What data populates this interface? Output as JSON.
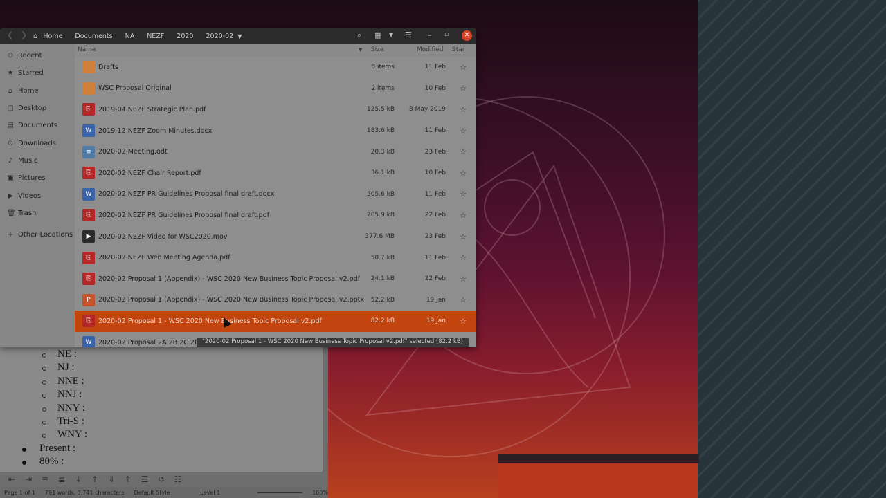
{
  "breadcrumb": {
    "items": [
      "Home",
      "Documents",
      "NA",
      "NEZF",
      "2020",
      "2020-02"
    ]
  },
  "icons": {
    "back": "chevron-left-icon",
    "forward": "chevron-right-icon",
    "home": "home-icon",
    "search": "search-icon",
    "view": "grid-view-icon",
    "menu": "hamburger-icon",
    "minimize": "minimize-icon",
    "maximize": "maximize-icon",
    "close": "close-icon"
  },
  "sidebar": {
    "items": [
      {
        "label": "Recent",
        "icon": "⏲"
      },
      {
        "label": "Starred",
        "icon": "★"
      },
      {
        "label": "Home",
        "icon": "⌂"
      },
      {
        "label": "Desktop",
        "icon": "▢"
      },
      {
        "label": "Documents",
        "icon": "▤"
      },
      {
        "label": "Downloads",
        "icon": "⊙"
      },
      {
        "label": "Music",
        "icon": "♪"
      },
      {
        "label": "Pictures",
        "icon": "▣"
      },
      {
        "label": "Videos",
        "icon": "▶"
      },
      {
        "label": "Trash",
        "icon": "🗑"
      },
      {
        "label": "Other Locations",
        "icon": "+"
      }
    ]
  },
  "columns": {
    "name": "Name",
    "size": "Size",
    "modified": "Modified",
    "star": "Star"
  },
  "files": [
    {
      "name": "Drafts",
      "size": "8 items",
      "modified": "11 Feb",
      "type": "folder"
    },
    {
      "name": "WSC Proposal Original",
      "size": "2 items",
      "modified": "10 Feb",
      "type": "folder"
    },
    {
      "name": "2019-04 NEZF Strategic Plan.pdf",
      "size": "125.5 kB",
      "modified": "8 May 2019",
      "type": "pdf"
    },
    {
      "name": "2019-12 NEZF Zoom Minutes.docx",
      "size": "183.6 kB",
      "modified": "11 Feb",
      "type": "doc"
    },
    {
      "name": "2020-02 Meeting.odt",
      "size": "20.3 kB",
      "modified": "23 Feb",
      "type": "odt"
    },
    {
      "name": "2020-02 NEZF Chair Report.pdf",
      "size": "36.1 kB",
      "modified": "10 Feb",
      "type": "pdf"
    },
    {
      "name": "2020-02 NEZF PR Guidelines Proposal final draft.docx",
      "size": "505.6 kB",
      "modified": "11 Feb",
      "type": "doc"
    },
    {
      "name": "2020-02 NEZF PR Guidelines Proposal final draft.pdf",
      "size": "205.9 kB",
      "modified": "22 Feb",
      "type": "pdf"
    },
    {
      "name": "2020-02 NEZF Video for WSC2020.mov",
      "size": "377.6 MB",
      "modified": "23 Feb",
      "type": "mov"
    },
    {
      "name": "2020-02 NEZF Web Meeting Agenda.pdf",
      "size": "50.7 kB",
      "modified": "11 Feb",
      "type": "pdf"
    },
    {
      "name": "2020-02 Proposal 1 (Appendix) - WSC 2020 New Business Topic Proposal v2.pdf",
      "size": "24.1 kB",
      "modified": "22 Feb",
      "type": "pdf"
    },
    {
      "name": "2020-02 Proposal 1 (Appendix) - WSC 2020 New Business Topic Proposal v2.pptx",
      "size": "52.2 kB",
      "modified": "19 Jan",
      "type": "ppt"
    },
    {
      "name": "2020-02 Proposal 1 - WSC 2020 New Business Topic Proposal v2.pdf",
      "size": "82.2 kB",
      "modified": "19 Jan",
      "type": "pdf",
      "selected": true
    },
    {
      "name": "2020-02 Proposal 2A 2B 2C 2D - (",
      "size": "",
      "modified": "",
      "type": "doc"
    }
  ],
  "status": {
    "selection": "\"2020-02 Proposal 1 - WSC 2020 New Business Topic Proposal v2.pdf\" selected  (82.2 kB)"
  },
  "document": {
    "sub_items": [
      "NE :",
      "NJ :",
      "NNE :",
      "NNJ :",
      "NNY :",
      "Tri-S :",
      "WNY :"
    ],
    "items": [
      "Present :",
      "80% :"
    ]
  },
  "writer_status": {
    "page": "Page 1 of 1",
    "words": "791 words, 3,741 characters",
    "style": "Default Style",
    "level": "Level 1",
    "zoom": "160%"
  }
}
